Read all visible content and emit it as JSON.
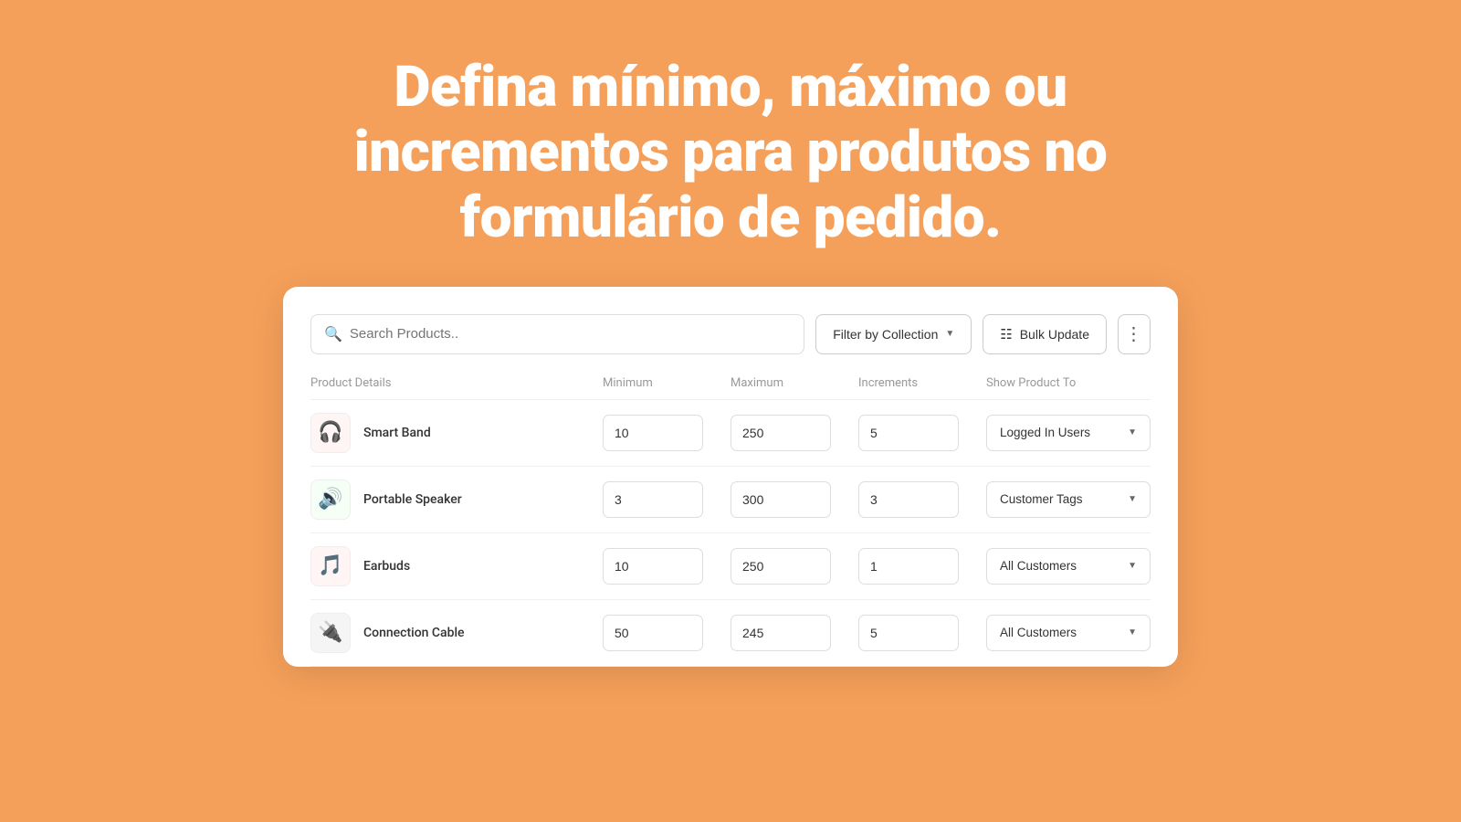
{
  "hero": {
    "line1": "Defina mínimo, máximo ou",
    "line2": "incrementos para produtos no",
    "line3": "formulário de pedido."
  },
  "toolbar": {
    "search_placeholder": "Search Products..",
    "filter_label": "Filter by Collection",
    "bulk_label": "Bulk Update",
    "more_label": "⋮"
  },
  "table": {
    "headers": {
      "product": "Product Details",
      "minimum": "Minimum",
      "maximum": "Maximum",
      "increments": "Increments",
      "show": "Show Product To"
    },
    "rows": [
      {
        "id": "smart-band",
        "icon": "🎧",
        "icon_class": "icon-smartband",
        "name": "Smart Band",
        "minimum": "10",
        "maximum": "250",
        "increments": "5",
        "show": "Logged In Users"
      },
      {
        "id": "portable-speaker",
        "icon": "🔊",
        "icon_class": "icon-speaker",
        "name": "Portable Speaker",
        "minimum": "3",
        "maximum": "300",
        "increments": "3",
        "show": "Customer Tags"
      },
      {
        "id": "earbuds",
        "icon": "🎵",
        "icon_class": "icon-earbuds",
        "name": "Earbuds",
        "minimum": "10",
        "maximum": "250",
        "increments": "1",
        "show": "All Customers"
      },
      {
        "id": "connection-cable",
        "icon": "🔌",
        "icon_class": "icon-cable",
        "name": "Connection Cable",
        "minimum": "50",
        "maximum": "245",
        "increments": "5",
        "show": "All Customers"
      }
    ]
  }
}
